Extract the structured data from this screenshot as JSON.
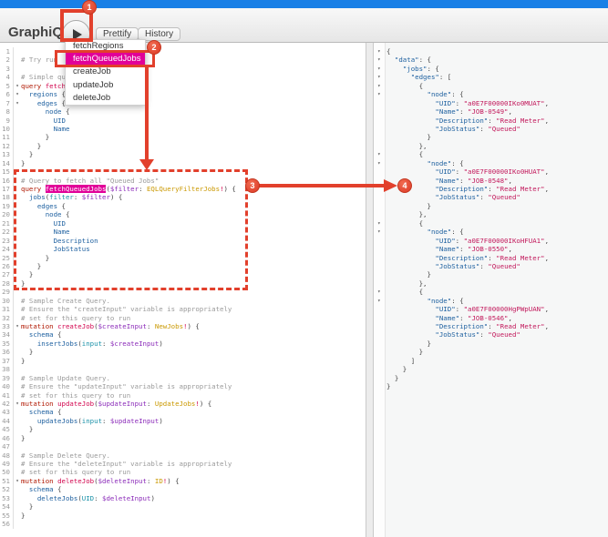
{
  "app": {
    "title": "GraphiQL"
  },
  "toolbar": {
    "execute_button": "run-query",
    "prettify_label": "Prettify",
    "history_label": "History"
  },
  "dropdown": {
    "items": [
      {
        "label": "fetchRegions",
        "selected": false
      },
      {
        "label": "fetchQueuedJobs",
        "selected": true
      },
      {
        "label": "createJob",
        "selected": false
      },
      {
        "label": "updateJob",
        "selected": false
      },
      {
        "label": "deleteJob",
        "selected": false
      }
    ],
    "highlight_color": "#e10098"
  },
  "annotations": {
    "color": "#e2402c",
    "steps": {
      "s1": "1",
      "s2": "2",
      "s3": "3",
      "s4": "4"
    }
  },
  "editor": {
    "fold_lines": [
      5,
      6,
      7,
      33,
      42,
      51
    ],
    "lines": [
      [],
      [
        [
          "cmt",
          "# Try run"
        ]
      ],
      [],
      [
        [
          "cmt",
          "# Simple qu"
        ]
      ],
      [
        [
          "kw",
          "query"
        ],
        [
          "plain",
          " "
        ],
        [
          "def",
          "fetch"
        ]
      ],
      [
        [
          "plain",
          "  "
        ],
        [
          "prop",
          "regions"
        ],
        [
          "punc",
          " {"
        ]
      ],
      [
        [
          "plain",
          "    "
        ],
        [
          "prop",
          "edges"
        ],
        [
          "punc",
          " {"
        ]
      ],
      [
        [
          "plain",
          "      "
        ],
        [
          "prop",
          "node"
        ],
        [
          "punc",
          " {"
        ]
      ],
      [
        [
          "plain",
          "        "
        ],
        [
          "prop",
          "UID"
        ]
      ],
      [
        [
          "plain",
          "        "
        ],
        [
          "prop",
          "Name"
        ]
      ],
      [
        [
          "punc",
          "      }"
        ]
      ],
      [
        [
          "punc",
          "    }"
        ]
      ],
      [
        [
          "punc",
          "  }"
        ]
      ],
      [
        [
          "punc",
          "}"
        ]
      ],
      [],
      [
        [
          "cmt",
          "# Query to fetch all \"Queued Jobs\""
        ]
      ],
      [
        [
          "kw",
          "query"
        ],
        [
          "plain",
          " "
        ],
        [
          "defhl",
          "fetchQueuedJobs"
        ],
        [
          "punc",
          "("
        ],
        [
          "var",
          "$filter"
        ],
        [
          "punc",
          ": "
        ],
        [
          "type",
          "EQLQueryFilterJobs"
        ],
        [
          "bang",
          "!"
        ],
        [
          "punc",
          ") {"
        ]
      ],
      [
        [
          "plain",
          "  "
        ],
        [
          "prop",
          "jobs"
        ],
        [
          "punc",
          "("
        ],
        [
          "attr",
          "filter"
        ],
        [
          "punc",
          ": "
        ],
        [
          "var",
          "$filter"
        ],
        [
          "punc",
          ") {"
        ]
      ],
      [
        [
          "plain",
          "    "
        ],
        [
          "prop",
          "edges"
        ],
        [
          "punc",
          " {"
        ]
      ],
      [
        [
          "plain",
          "      "
        ],
        [
          "prop",
          "node"
        ],
        [
          "punc",
          " {"
        ]
      ],
      [
        [
          "plain",
          "        "
        ],
        [
          "prop",
          "UID"
        ]
      ],
      [
        [
          "plain",
          "        "
        ],
        [
          "prop",
          "Name"
        ]
      ],
      [
        [
          "plain",
          "        "
        ],
        [
          "prop",
          "Description"
        ]
      ],
      [
        [
          "plain",
          "        "
        ],
        [
          "prop",
          "JobStatus"
        ]
      ],
      [
        [
          "punc",
          "      }"
        ]
      ],
      [
        [
          "punc",
          "    }"
        ]
      ],
      [
        [
          "punc",
          "  }"
        ]
      ],
      [
        [
          "punc",
          "}"
        ]
      ],
      [],
      [
        [
          "cmt",
          "# Sample Create Query."
        ]
      ],
      [
        [
          "cmt",
          "# Ensure the \"createInput\" variable is appropriately"
        ]
      ],
      [
        [
          "cmt",
          "# set for this query to run"
        ]
      ],
      [
        [
          "kw",
          "mutation"
        ],
        [
          "plain",
          " "
        ],
        [
          "def",
          "createJob"
        ],
        [
          "punc",
          "("
        ],
        [
          "var",
          "$createInput"
        ],
        [
          "punc",
          ": "
        ],
        [
          "type",
          "NewJobs"
        ],
        [
          "bang",
          "!"
        ],
        [
          "punc",
          ") {"
        ]
      ],
      [
        [
          "plain",
          "  "
        ],
        [
          "prop",
          "schema"
        ],
        [
          "punc",
          " {"
        ]
      ],
      [
        [
          "plain",
          "    "
        ],
        [
          "prop",
          "insertJobs"
        ],
        [
          "punc",
          "("
        ],
        [
          "attr",
          "input"
        ],
        [
          "punc",
          ": "
        ],
        [
          "var",
          "$createInput"
        ],
        [
          "punc",
          ")"
        ]
      ],
      [
        [
          "punc",
          "  }"
        ]
      ],
      [
        [
          "punc",
          "}"
        ]
      ],
      [],
      [
        [
          "cmt",
          "# Sample Update Query."
        ]
      ],
      [
        [
          "cmt",
          "# Ensure the \"updateInput\" variable is appropriately"
        ]
      ],
      [
        [
          "cmt",
          "# set for this query to run"
        ]
      ],
      [
        [
          "kw",
          "mutation"
        ],
        [
          "plain",
          " "
        ],
        [
          "def",
          "updateJob"
        ],
        [
          "punc",
          "("
        ],
        [
          "var",
          "$updateInput"
        ],
        [
          "punc",
          ": "
        ],
        [
          "type",
          "UpdateJobs"
        ],
        [
          "bang",
          "!"
        ],
        [
          "punc",
          ") {"
        ]
      ],
      [
        [
          "plain",
          "  "
        ],
        [
          "prop",
          "schema"
        ],
        [
          "punc",
          " {"
        ]
      ],
      [
        [
          "plain",
          "    "
        ],
        [
          "prop",
          "updateJobs"
        ],
        [
          "punc",
          "("
        ],
        [
          "attr",
          "input"
        ],
        [
          "punc",
          ": "
        ],
        [
          "var",
          "$updateInput"
        ],
        [
          "punc",
          ")"
        ]
      ],
      [
        [
          "punc",
          "  }"
        ]
      ],
      [
        [
          "punc",
          "}"
        ]
      ],
      [],
      [
        [
          "cmt",
          "# Sample Delete Query."
        ]
      ],
      [
        [
          "cmt",
          "# Ensure the \"deleteInput\" variable is appropriately"
        ]
      ],
      [
        [
          "cmt",
          "# set for this query to run"
        ]
      ],
      [
        [
          "kw",
          "mutation"
        ],
        [
          "plain",
          " "
        ],
        [
          "def",
          "deleteJob"
        ],
        [
          "punc",
          "("
        ],
        [
          "var",
          "$deleteInput"
        ],
        [
          "punc",
          ": "
        ],
        [
          "type",
          "ID"
        ],
        [
          "bang",
          "!"
        ],
        [
          "punc",
          ") {"
        ]
      ],
      [
        [
          "plain",
          "  "
        ],
        [
          "prop",
          "schema"
        ],
        [
          "punc",
          " {"
        ]
      ],
      [
        [
          "plain",
          "    "
        ],
        [
          "prop",
          "deleteJobs"
        ],
        [
          "punc",
          "("
        ],
        [
          "attr",
          "UID"
        ],
        [
          "punc",
          ": "
        ],
        [
          "var",
          "$deleteInput"
        ],
        [
          "punc",
          ")"
        ]
      ],
      [
        [
          "punc",
          "  }"
        ]
      ],
      [
        [
          "punc",
          "}"
        ]
      ],
      []
    ]
  },
  "result": {
    "fold_lines": [
      1,
      2,
      3,
      4,
      5,
      6,
      13,
      14,
      21,
      22,
      29,
      30
    ],
    "response_json": {
      "data": {
        "jobs": {
          "edges": [
            {
              "node": {
                "UID": "a0E7F00000IKo0MUAT",
                "Name": "JOB-0549",
                "Description": "Read Meter",
                "JobStatus": "Queued"
              }
            },
            {
              "node": {
                "UID": "a0E7F00000IKo0HUAT",
                "Name": "JOB-0548",
                "Description": "Read Meter",
                "JobStatus": "Queued"
              }
            },
            {
              "node": {
                "UID": "a0E7F00000IKoHFUA1",
                "Name": "JOB-0550",
                "Description": "Read Meter",
                "JobStatus": "Queued"
              }
            },
            {
              "node": {
                "UID": "a0E7F00000HgPWpUAN",
                "Name": "JOB-0546",
                "Description": "Read Meter",
                "JobStatus": "Queued"
              }
            }
          ]
        }
      }
    },
    "lines": [
      [
        [
          "punc",
          "{"
        ]
      ],
      [
        [
          "plain",
          "  "
        ],
        [
          "key",
          "\"data\""
        ],
        [
          "punc",
          ": {"
        ]
      ],
      [
        [
          "plain",
          "    "
        ],
        [
          "key",
          "\"jobs\""
        ],
        [
          "punc",
          ": {"
        ]
      ],
      [
        [
          "plain",
          "      "
        ],
        [
          "key",
          "\"edges\""
        ],
        [
          "punc",
          ": ["
        ]
      ],
      [
        [
          "punc",
          "        {"
        ]
      ],
      [
        [
          "plain",
          "          "
        ],
        [
          "key",
          "\"node\""
        ],
        [
          "punc",
          ": {"
        ]
      ],
      [
        [
          "plain",
          "            "
        ],
        [
          "key",
          "\"UID\""
        ],
        [
          "punc",
          ": "
        ],
        [
          "str",
          "\"a0E7F00000IKo0MUAT\""
        ],
        [
          "punc",
          ","
        ]
      ],
      [
        [
          "plain",
          "            "
        ],
        [
          "key",
          "\"Name\""
        ],
        [
          "punc",
          ": "
        ],
        [
          "str",
          "\"JOB-0549\""
        ],
        [
          "punc",
          ","
        ]
      ],
      [
        [
          "plain",
          "            "
        ],
        [
          "key",
          "\"Description\""
        ],
        [
          "punc",
          ": "
        ],
        [
          "str",
          "\"Read Meter\""
        ],
        [
          "punc",
          ","
        ]
      ],
      [
        [
          "plain",
          "            "
        ],
        [
          "key",
          "\"JobStatus\""
        ],
        [
          "punc",
          ": "
        ],
        [
          "str",
          "\"Queued\""
        ]
      ],
      [
        [
          "punc",
          "          }"
        ]
      ],
      [
        [
          "punc",
          "        },"
        ]
      ],
      [
        [
          "punc",
          "        {"
        ]
      ],
      [
        [
          "plain",
          "          "
        ],
        [
          "key",
          "\"node\""
        ],
        [
          "punc",
          ": {"
        ]
      ],
      [
        [
          "plain",
          "            "
        ],
        [
          "key",
          "\"UID\""
        ],
        [
          "punc",
          ": "
        ],
        [
          "str",
          "\"a0E7F00000IKo0HUAT\""
        ],
        [
          "punc",
          ","
        ]
      ],
      [
        [
          "plain",
          "            "
        ],
        [
          "key",
          "\"Name\""
        ],
        [
          "punc",
          ": "
        ],
        [
          "str",
          "\"JOB-0548\""
        ],
        [
          "punc",
          ","
        ]
      ],
      [
        [
          "plain",
          "            "
        ],
        [
          "key",
          "\"Description\""
        ],
        [
          "punc",
          ": "
        ],
        [
          "str",
          "\"Read Meter\""
        ],
        [
          "punc",
          ","
        ]
      ],
      [
        [
          "plain",
          "            "
        ],
        [
          "key",
          "\"JobStatus\""
        ],
        [
          "punc",
          ": "
        ],
        [
          "str",
          "\"Queued\""
        ]
      ],
      [
        [
          "punc",
          "          }"
        ]
      ],
      [
        [
          "punc",
          "        },"
        ]
      ],
      [
        [
          "punc",
          "        {"
        ]
      ],
      [
        [
          "plain",
          "          "
        ],
        [
          "key",
          "\"node\""
        ],
        [
          "punc",
          ": {"
        ]
      ],
      [
        [
          "plain",
          "            "
        ],
        [
          "key",
          "\"UID\""
        ],
        [
          "punc",
          ": "
        ],
        [
          "str",
          "\"a0E7F00000IKoHFUA1\""
        ],
        [
          "punc",
          ","
        ]
      ],
      [
        [
          "plain",
          "            "
        ],
        [
          "key",
          "\"Name\""
        ],
        [
          "punc",
          ": "
        ],
        [
          "str",
          "\"JOB-0550\""
        ],
        [
          "punc",
          ","
        ]
      ],
      [
        [
          "plain",
          "            "
        ],
        [
          "key",
          "\"Description\""
        ],
        [
          "punc",
          ": "
        ],
        [
          "str",
          "\"Read Meter\""
        ],
        [
          "punc",
          ","
        ]
      ],
      [
        [
          "plain",
          "            "
        ],
        [
          "key",
          "\"JobStatus\""
        ],
        [
          "punc",
          ": "
        ],
        [
          "str",
          "\"Queued\""
        ]
      ],
      [
        [
          "punc",
          "          }"
        ]
      ],
      [
        [
          "punc",
          "        },"
        ]
      ],
      [
        [
          "punc",
          "        {"
        ]
      ],
      [
        [
          "plain",
          "          "
        ],
        [
          "key",
          "\"node\""
        ],
        [
          "punc",
          ": {"
        ]
      ],
      [
        [
          "plain",
          "            "
        ],
        [
          "key",
          "\"UID\""
        ],
        [
          "punc",
          ": "
        ],
        [
          "str",
          "\"a0E7F00000HgPWpUAN\""
        ],
        [
          "punc",
          ","
        ]
      ],
      [
        [
          "plain",
          "            "
        ],
        [
          "key",
          "\"Name\""
        ],
        [
          "punc",
          ": "
        ],
        [
          "str",
          "\"JOB-0546\""
        ],
        [
          "punc",
          ","
        ]
      ],
      [
        [
          "plain",
          "            "
        ],
        [
          "key",
          "\"Description\""
        ],
        [
          "punc",
          ": "
        ],
        [
          "str",
          "\"Read Meter\""
        ],
        [
          "punc",
          ","
        ]
      ],
      [
        [
          "plain",
          "            "
        ],
        [
          "key",
          "\"JobStatus\""
        ],
        [
          "punc",
          ": "
        ],
        [
          "str",
          "\"Queued\""
        ]
      ],
      [
        [
          "punc",
          "          }"
        ]
      ],
      [
        [
          "punc",
          "        }"
        ]
      ],
      [
        [
          "punc",
          "      ]"
        ]
      ],
      [
        [
          "punc",
          "    }"
        ]
      ],
      [
        [
          "punc",
          "  }"
        ]
      ],
      [
        [
          "punc",
          "}"
        ]
      ]
    ]
  }
}
